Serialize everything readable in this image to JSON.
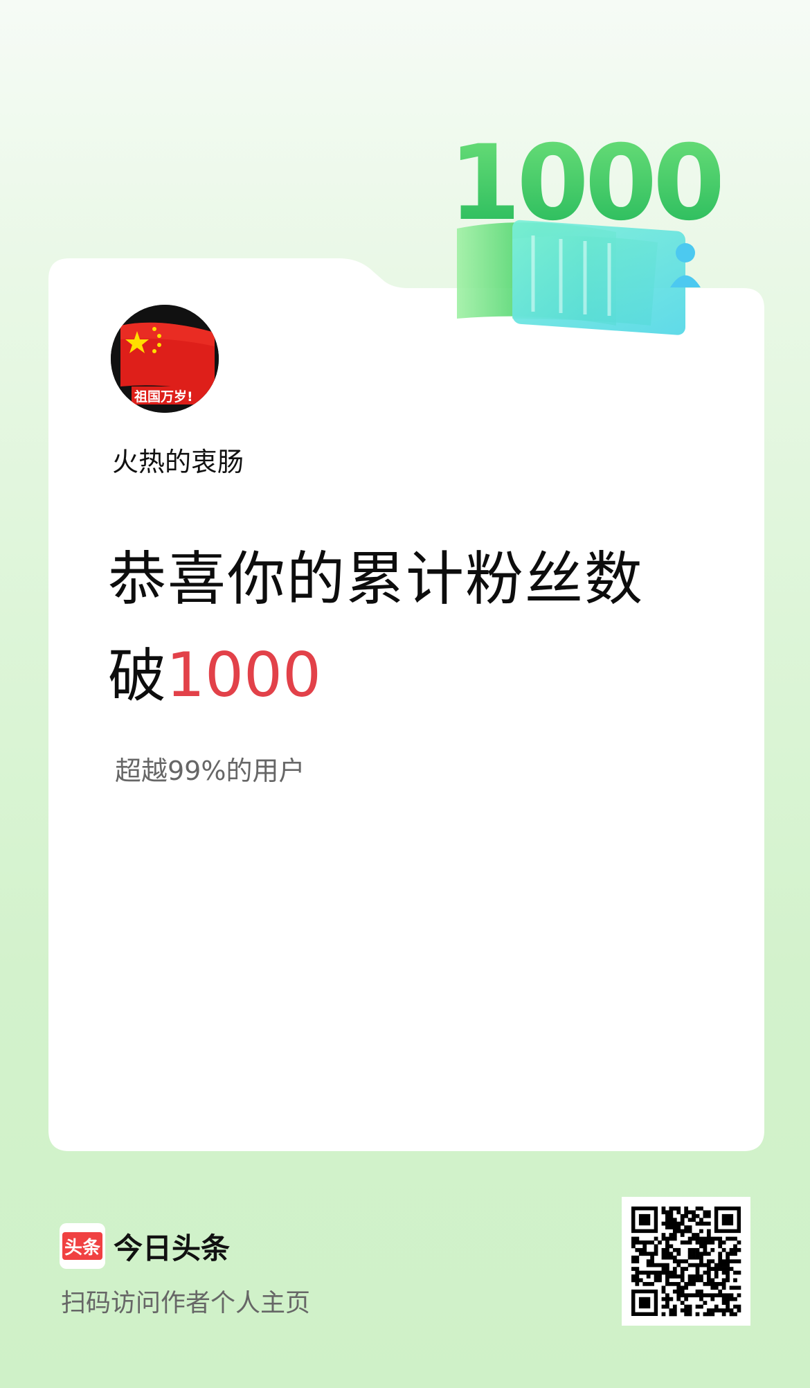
{
  "badge": {
    "text": "1000"
  },
  "author": {
    "name": "火热的衷肠",
    "avatar_caption": "祖国万岁!"
  },
  "headline": {
    "line1": "恭喜你的累计粉丝数",
    "line2_prefix": "破",
    "line2_number": "1000"
  },
  "subline": "超越99%的用户",
  "footer": {
    "logo_mark": "头条",
    "app_name": "今日头条",
    "hint": "扫码访问作者个人主页"
  },
  "colors": {
    "accent_red": "#e24149",
    "logo_red": "#f04142",
    "badge_green": "#3fcf63"
  }
}
